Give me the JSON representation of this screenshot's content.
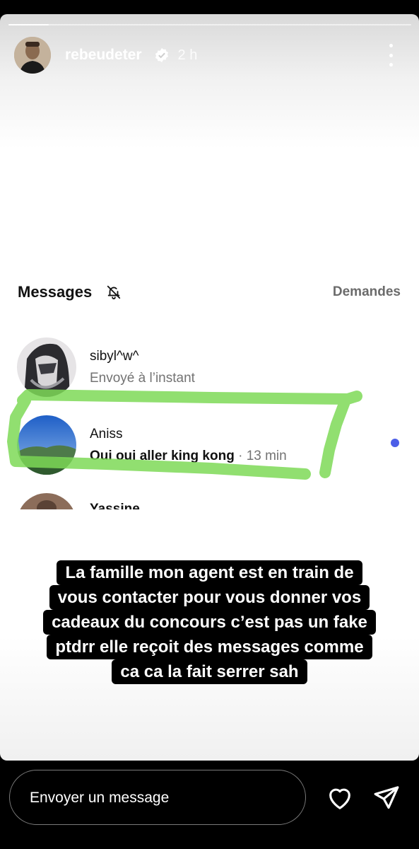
{
  "story": {
    "username": "rebeudeter",
    "time": "2 h",
    "progress": 0.1
  },
  "screenshot": {
    "title": "Messages",
    "requests_label": "Demandes",
    "conversations": [
      {
        "name": "sibyl^w^",
        "subtitle": "Envoyé à l’instant"
      },
      {
        "name": "Aniss",
        "subtitle": "Oui oui aller king kong",
        "time": " · 13 min",
        "unread": true
      },
      {
        "name": "Yassine"
      }
    ]
  },
  "caption_lines": [
    "La famille mon agent est en train de",
    "vous contacter pour vous donner vos",
    "cadeaux du concours c’est pas un fake",
    "ptdrr elle reçoit des messages comme",
    "ca ca la fait serrer sah"
  ],
  "composer": {
    "placeholder": "Envoyer un message"
  },
  "icons": {
    "verified": "verified-badge-icon",
    "more": "more-vertical-icon",
    "bell": "bell-off-icon",
    "heart": "heart-icon",
    "send": "send-icon"
  },
  "colors": {
    "highlight": "#7ed957",
    "unread": "#4c5ee8"
  }
}
